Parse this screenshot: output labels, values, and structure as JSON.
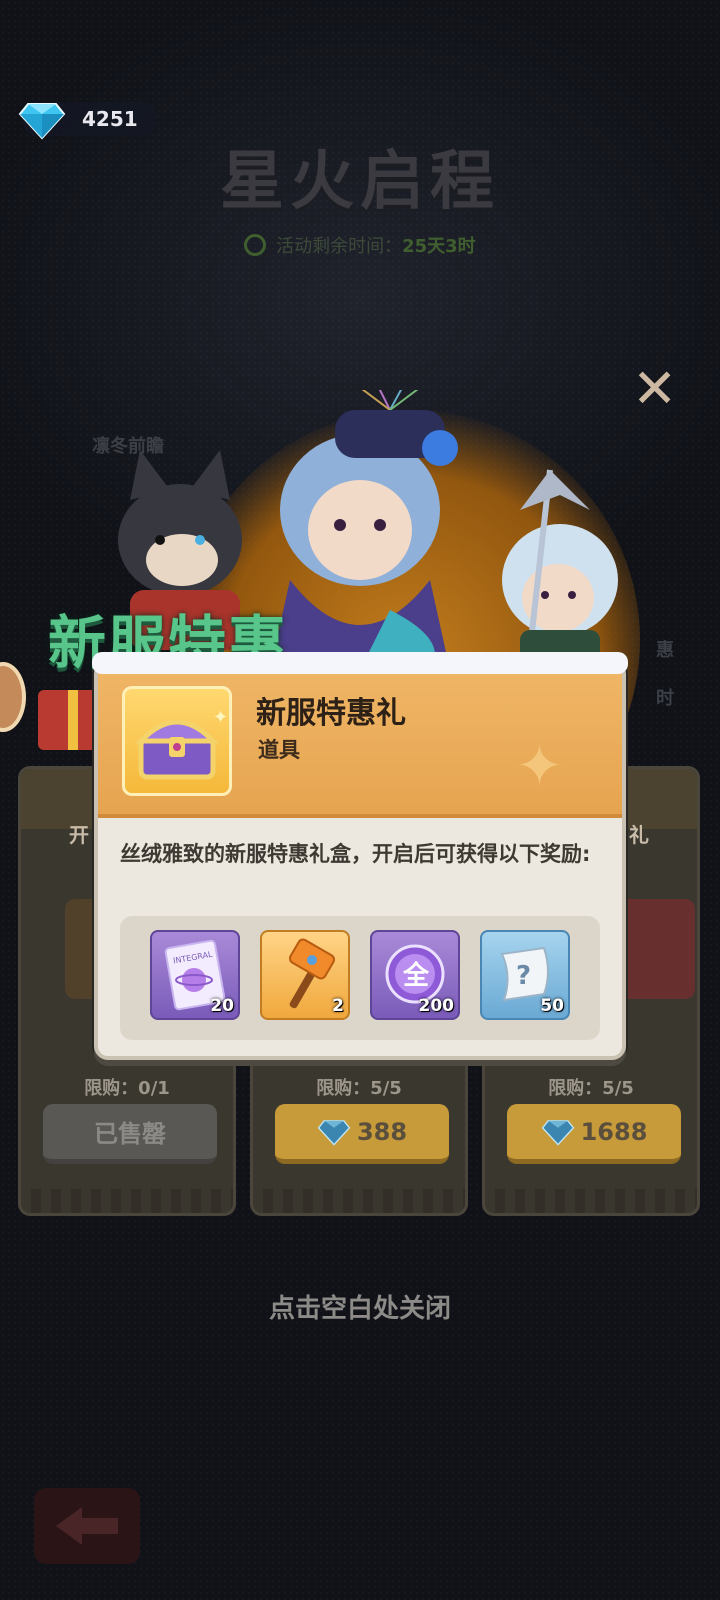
{
  "currency": {
    "gems": "4251",
    "icon": "diamond-icon"
  },
  "event": {
    "title": "星火启程",
    "timer_label": "活动剩余时间：",
    "timer_value": "25天3时"
  },
  "background_labels": {
    "left_tag": "凛冬前瞻",
    "right_tag_1": "惠",
    "right_tag_2": "时"
  },
  "promo_title": "新服特惠",
  "shop": {
    "cards": [
      {
        "name": "开",
        "limit": "限购：0/1",
        "button": "已售罄",
        "state": "sold-out"
      },
      {
        "name": "",
        "limit": "限购：5/5",
        "price": "388",
        "state": "available"
      },
      {
        "name": "礼",
        "limit": "限购：5/5",
        "price": "1688",
        "state": "available"
      }
    ]
  },
  "popup": {
    "title": "新服特惠礼",
    "type": "道具",
    "description": "丝绒雅致的新服特惠礼盒，开启后可获得以下奖励:",
    "rewards": [
      {
        "icon": "integral-ticket-icon",
        "qty": "20",
        "color": "#8a6cc8"
      },
      {
        "icon": "hammer-icon",
        "qty": "2",
        "color": "#f0a83d"
      },
      {
        "icon": "quan-orb-icon",
        "qty": "200",
        "color": "#8a6cc8"
      },
      {
        "icon": "mystery-scroll-icon",
        "qty": "50",
        "color": "#6aa9d4"
      }
    ],
    "reward_ticket_text": "INTEGRAL",
    "reward_orb_text": "全",
    "reward_scroll_text": "?"
  },
  "tap_to_close": "点击空白处关闭",
  "colors": {
    "accent_gold": "#c79a3a",
    "popup_header": "#e6a450",
    "promo_green": "#58c58a"
  }
}
